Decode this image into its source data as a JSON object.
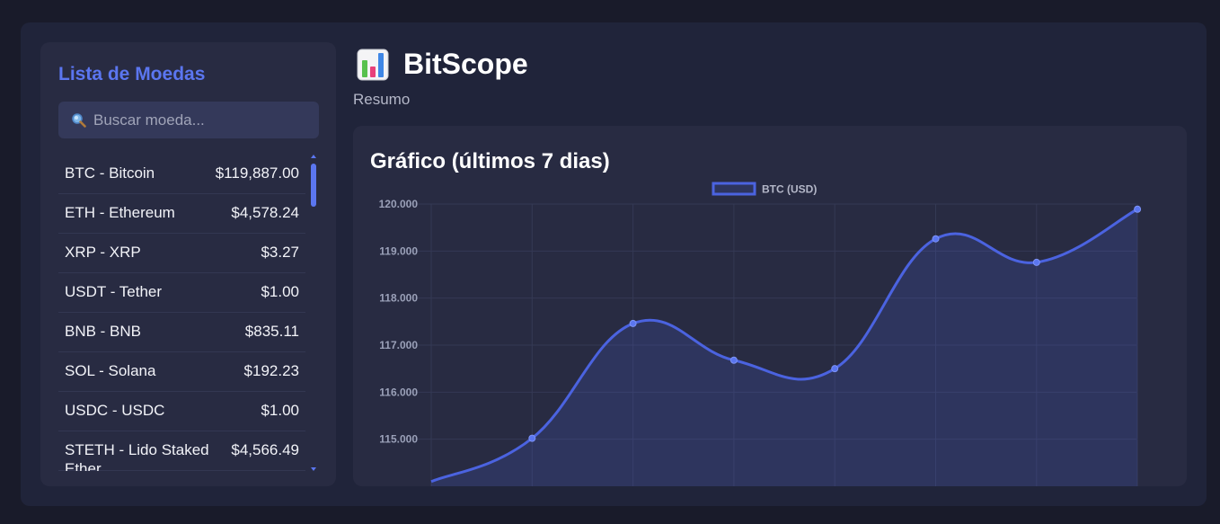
{
  "sidebar": {
    "title": "Lista de Moedas",
    "search_placeholder": "Buscar moeda...",
    "coins": [
      {
        "name": "BTC - Bitcoin",
        "price": "$119,887.00"
      },
      {
        "name": "ETH - Ethereum",
        "price": "$4,578.24"
      },
      {
        "name": "XRP - XRP",
        "price": "$3.27"
      },
      {
        "name": "USDT - Tether",
        "price": "$1.00"
      },
      {
        "name": "BNB - BNB",
        "price": "$835.11"
      },
      {
        "name": "SOL - Solana",
        "price": "$192.23"
      },
      {
        "name": "USDC - USDC",
        "price": "$1.00"
      },
      {
        "name": "STETH - Lido Staked Ether",
        "price": "$4,566.49"
      }
    ]
  },
  "header": {
    "title": "BitScope",
    "icon": "bar-chart-icon",
    "subtitle": "Resumo"
  },
  "colors": {
    "accent": "#5b76f0",
    "line": "#4b63e0",
    "background": "#191b2a",
    "panel": "#282b42"
  },
  "chart_data": {
    "type": "line",
    "title": "Gráfico (últimos 7 dias)",
    "series": [
      {
        "name": "BTC (USD)",
        "values": [
          114100,
          115020,
          117460,
          116680,
          116500,
          119260,
          118760,
          119890
        ]
      }
    ],
    "y_ticks": [
      "115.000",
      "116.000",
      "117.000",
      "118.000",
      "119.000",
      "120.000"
    ],
    "y_tick_values": [
      115000,
      116000,
      117000,
      118000,
      119000,
      120000
    ],
    "ylim": [
      114000,
      120000
    ],
    "legend_position": "top-center",
    "grid": true,
    "fill": true,
    "smooth": true
  }
}
